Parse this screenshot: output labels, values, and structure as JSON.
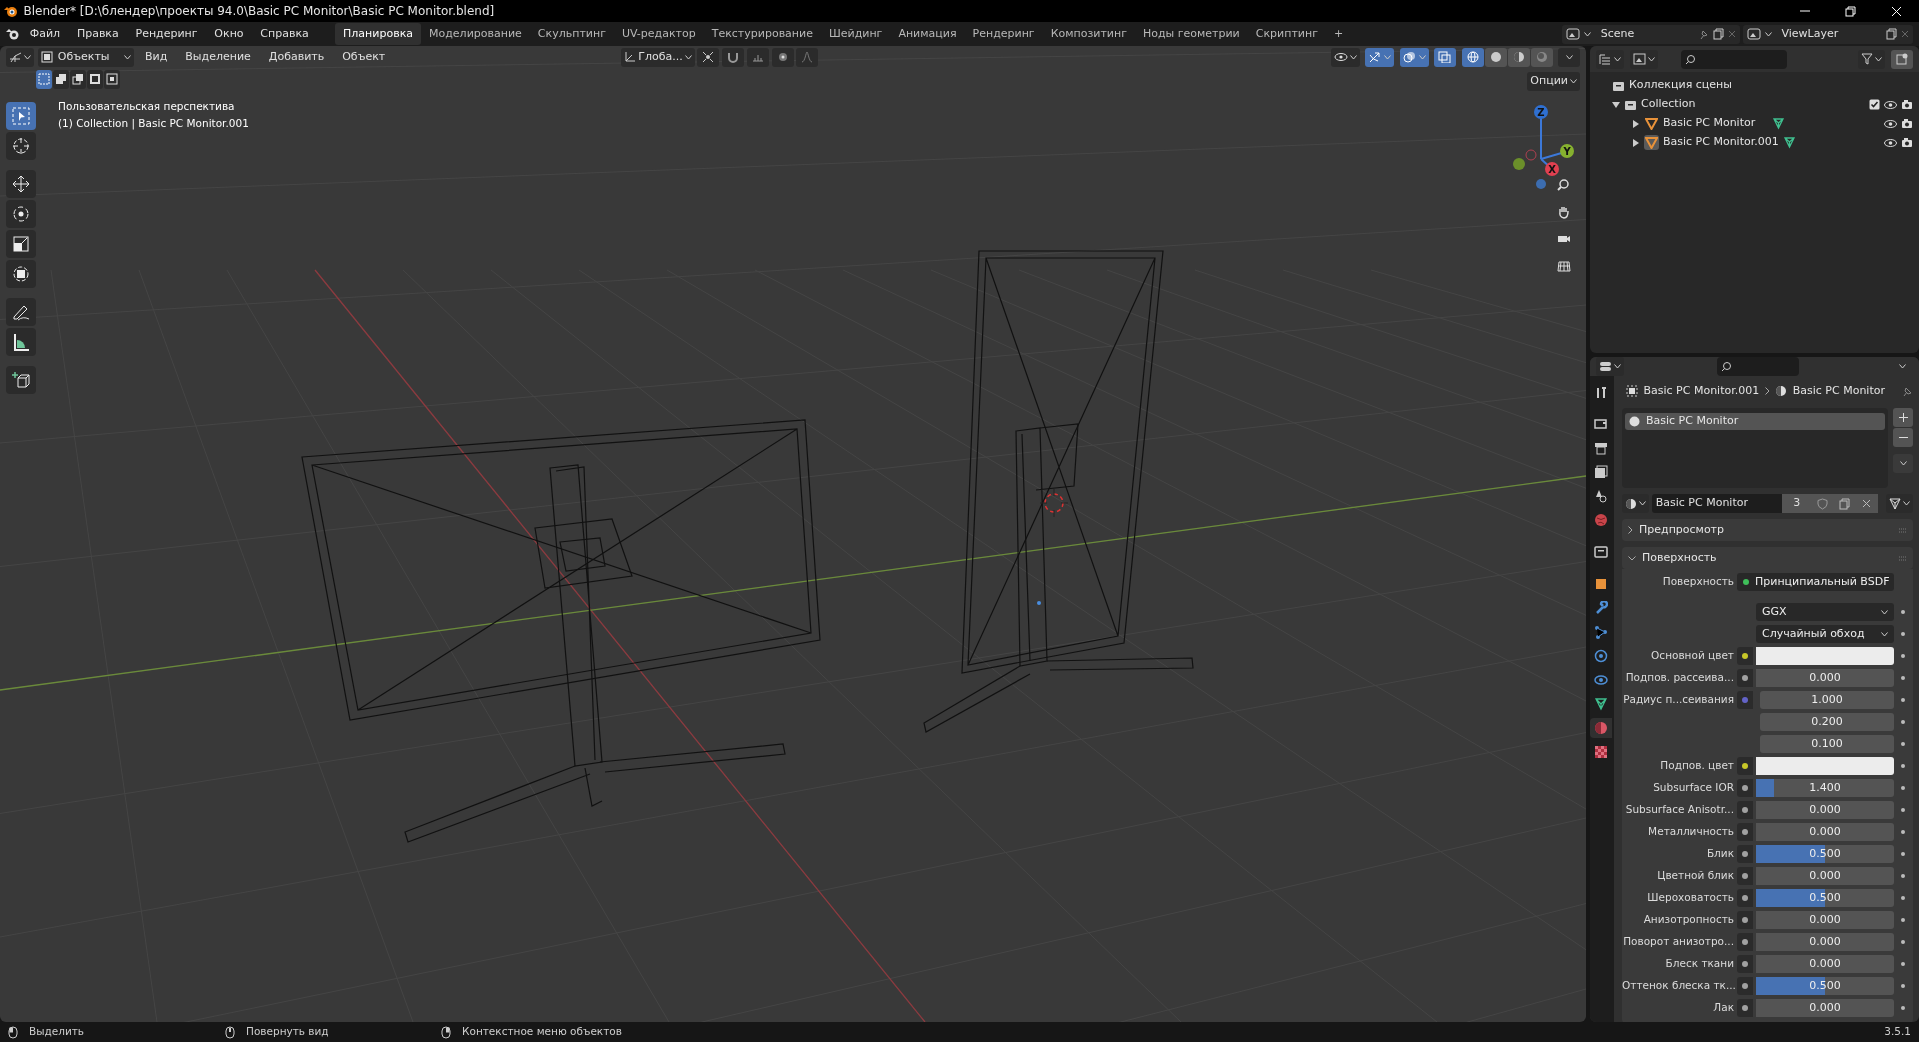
{
  "window": {
    "title": "Blender* [D:\\блендер\\проекты 94.0\\Basic PC Monitor\\Basic PC Monitor.blend]"
  },
  "menu": [
    "Файл",
    "Правка",
    "Рендеринг",
    "Окно",
    "Справка"
  ],
  "workspaces": [
    {
      "label": "Планировка",
      "selected": true
    },
    {
      "label": "Моделирование",
      "selected": false
    },
    {
      "label": "Скульптинг",
      "selected": false
    },
    {
      "label": "UV-редактор",
      "selected": false
    },
    {
      "label": "Текстурирование",
      "selected": false
    },
    {
      "label": "Шейдинг",
      "selected": false
    },
    {
      "label": "Анимация",
      "selected": false
    },
    {
      "label": "Рендеринг",
      "selected": false
    },
    {
      "label": "Композитинг",
      "selected": false
    },
    {
      "label": "Ноды геометрии",
      "selected": false
    },
    {
      "label": "Скриптинг",
      "selected": false
    }
  ],
  "add_workspace": "+",
  "scene": "Scene",
  "view_layer": "ViewLayer",
  "viewport": {
    "mode": "Объекты",
    "menus": [
      "Вид",
      "Выделение",
      "Добавить",
      "Объект"
    ],
    "orientation": "Глоба...",
    "toggles": [
      {
        "kind": "eye",
        "active": false
      },
      {
        "kind": "gizmo",
        "active": true
      },
      {
        "kind": "overlay",
        "active": true
      },
      {
        "kind": "xray",
        "active": true
      }
    ],
    "shading": [
      {
        "kind": "wireframe",
        "selected": true
      },
      {
        "kind": "solid",
        "selected": false
      },
      {
        "kind": "material",
        "selected": false
      },
      {
        "kind": "rendered",
        "selected": false
      }
    ],
    "select_modes": [
      {
        "selected": true
      },
      {
        "selected": false
      },
      {
        "selected": false
      },
      {
        "selected": false
      },
      {
        "selected": false
      }
    ],
    "options": "Опции",
    "info": [
      "Пользовательская перспектива",
      "(1) Collection | Basic PC Monitor.001"
    ],
    "gizmo_axes": [
      "Z",
      "Y",
      "X"
    ],
    "tools": [
      {
        "kind": "select",
        "selected": true
      },
      {
        "kind": "cursor",
        "selected": false
      },
      {
        "kind": "move",
        "selected": false
      },
      {
        "kind": "rotate",
        "selected": false
      },
      {
        "kind": "scale",
        "selected": false
      },
      {
        "kind": "transform",
        "selected": false
      },
      {
        "kind": "annotate",
        "selected": false
      },
      {
        "kind": "measure",
        "selected": false
      },
      {
        "kind": "add_cube",
        "selected": false
      }
    ]
  },
  "outliner": {
    "root": "Коллекция сцены",
    "collections": [
      {
        "name": "Collection",
        "expanded": true,
        "checked": true,
        "children": [
          {
            "name": "Basic PC Monitor",
            "expanded": false,
            "active": false
          },
          {
            "name": "Basic PC Monitor.001",
            "expanded": false,
            "active": true
          }
        ]
      }
    ]
  },
  "properties": {
    "tabs": [
      {
        "kind": "tool",
        "selected": false
      },
      {
        "kind": "render",
        "selected": false
      },
      {
        "kind": "output",
        "selected": false
      },
      {
        "kind": "view_layer",
        "selected": false
      },
      {
        "kind": "scene",
        "selected": false
      },
      {
        "kind": "world",
        "selected": false
      },
      {
        "kind": "collection",
        "selected": false
      },
      {
        "kind": "object",
        "selected": false
      },
      {
        "kind": "modifiers",
        "selected": false
      },
      {
        "kind": "particles",
        "selected": false
      },
      {
        "kind": "physics",
        "selected": false
      },
      {
        "kind": "constraints",
        "selected": false
      },
      {
        "kind": "data",
        "selected": false
      },
      {
        "kind": "material",
        "selected": true
      },
      {
        "kind": "texture",
        "selected": false
      }
    ],
    "breadcrumb": [
      "Basic PC Monitor.001",
      "Basic PC Monitor"
    ],
    "slots": [
      {
        "name": "Basic PC Monitor",
        "selected": true
      }
    ],
    "material": "Basic PC Monitor",
    "users": "3",
    "panels": [
      {
        "label": "Предпросмотр",
        "expanded": false
      },
      {
        "label": "Поверхность",
        "expanded": true
      }
    ],
    "rows": [
      {
        "kind": "shader",
        "label": "Поверхность",
        "value": "Принципиальный BSDF"
      },
      {
        "kind": "dropdown",
        "value": "GGX"
      },
      {
        "kind": "dropdown",
        "value": "Случайный обход"
      },
      {
        "kind": "color",
        "label": "Основной цвет",
        "color": "#ececec"
      },
      {
        "kind": "slider",
        "label": "Подпов. рассеива...",
        "value": "0.000",
        "level": 0
      },
      {
        "kind": "vector",
        "label": "Радиус п...сеивания",
        "values": [
          "1.000",
          "0.200",
          "0.100"
        ]
      },
      {
        "kind": "color",
        "label": "Подпов. цвет",
        "color": "#ececec"
      },
      {
        "kind": "slider",
        "label": "Subsurface IOR",
        "value": "1.400",
        "level": 0.13
      },
      {
        "kind": "slider",
        "label": "Subsurface Anisotr...",
        "value": "0.000",
        "level": 0
      },
      {
        "kind": "slider",
        "label": "Металличность",
        "value": "0.000",
        "level": 0
      },
      {
        "kind": "slider",
        "label": "Блик",
        "value": "0.500",
        "level": 0.5
      },
      {
        "kind": "slider",
        "label": "Цветной блик",
        "value": "0.000",
        "level": 0
      },
      {
        "kind": "slider",
        "label": "Шероховатость",
        "value": "0.500",
        "level": 0.5
      },
      {
        "kind": "slider",
        "label": "Анизотропность",
        "value": "0.000",
        "level": 0
      },
      {
        "kind": "slider",
        "label": "Поворот анизотро...",
        "value": "0.000",
        "level": 0
      },
      {
        "kind": "slider",
        "label": "Блеск ткани",
        "value": "0.000",
        "level": 0
      },
      {
        "kind": "slider",
        "label": "Оттенок блеска тк...",
        "value": "0.500",
        "level": 0.5
      },
      {
        "kind": "slider",
        "label": "Лак",
        "value": "0.000",
        "level": 0
      }
    ]
  },
  "status_bar": {
    "items": [
      "Выделить",
      "Повернуть вид",
      "Контекстное меню объектов"
    ],
    "version": "3.5.1"
  }
}
